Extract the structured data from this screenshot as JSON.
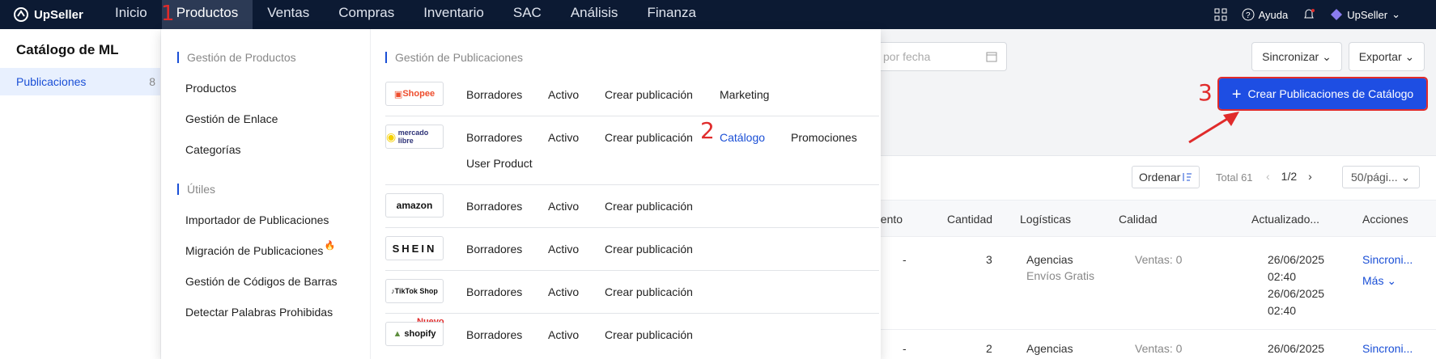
{
  "app": {
    "name": "UpSeller"
  },
  "nav": {
    "items": [
      {
        "label": "Inicio"
      },
      {
        "label": "Productos"
      },
      {
        "label": "Ventas"
      },
      {
        "label": "Compras"
      },
      {
        "label": "Inventario"
      },
      {
        "label": "SAC"
      },
      {
        "label": "Análisis"
      },
      {
        "label": "Finanza"
      }
    ]
  },
  "topright": {
    "help": "Ayuda",
    "user": "UpSeller"
  },
  "sidebar": {
    "title": "Catálogo de ML",
    "items": [
      {
        "label": "Publicaciones",
        "count": "8"
      }
    ]
  },
  "filters": {
    "date_placeholder": "por fecha"
  },
  "toolbar": {
    "sync": "Sincronizar",
    "export": "Exportar",
    "create": "Crear Publicaciones de Catálogo"
  },
  "annotations": {
    "n1": "1",
    "n2": "2",
    "n3": "3"
  },
  "table": {
    "sort": "Ordenar",
    "total": "Total 61",
    "page": "1/2",
    "per_page": "50/pági...",
    "headers": [
      "uento",
      "Cantidad",
      "Logísticas",
      "Calidad",
      "Actualizado...",
      "Acciones"
    ],
    "rows": [
      {
        "c1": "-",
        "qty": "3",
        "log1": "Agencias",
        "log2": "Envíos Gratis",
        "quality": "Ventas: 0",
        "d1": "26/06/2025",
        "t1": "02:40",
        "d2": "26/06/2025",
        "t2": "02:40",
        "action": "Sincroni...",
        "more": "Más"
      },
      {
        "c1": "-",
        "qty": "2",
        "log1": "Agencias",
        "quality": "Ventas: 0",
        "d1": "26/06/2025",
        "action": "Sincroni..."
      }
    ]
  },
  "dropdown": {
    "gestion": {
      "heading": "Gestión de Productos",
      "links": [
        "Productos",
        "Gestión de Enlace",
        "Categorías"
      ]
    },
    "utiles": {
      "heading": "Útiles",
      "links": [
        "Importador de Publicaciones",
        "Migración de Publicaciones",
        "Gestión de Códigos de Barras",
        "Detectar Palabras Prohibidas"
      ]
    },
    "publicaciones": {
      "heading": "Gestión de Publicaciones",
      "platforms": [
        {
          "logo": "Shopee",
          "links": [
            "Borradores",
            "Activo",
            "Crear publicación",
            "Marketing"
          ]
        },
        {
          "logo": "mercado libre",
          "links": [
            "Borradores",
            "Activo",
            "Crear publicación",
            "Catálogo",
            "Promociones",
            "User Product"
          ]
        },
        {
          "logo": "amazon",
          "links": [
            "Borradores",
            "Activo",
            "Crear publicación"
          ]
        },
        {
          "logo": "SHEIN",
          "links": [
            "Borradores",
            "Activo",
            "Crear publicación"
          ]
        },
        {
          "logo": "TikTok Shop",
          "links": [
            "Borradores",
            "Activo",
            "Crear publicación"
          ]
        },
        {
          "logo": "shopify",
          "badge": "Nuevo",
          "links": [
            "Borradores",
            "Activo",
            "Crear publicación"
          ]
        }
      ]
    }
  },
  "colors": {
    "nav_bg": "#0c1a33",
    "accent": "#1e4ee3",
    "annotation": "#e02b2b"
  }
}
